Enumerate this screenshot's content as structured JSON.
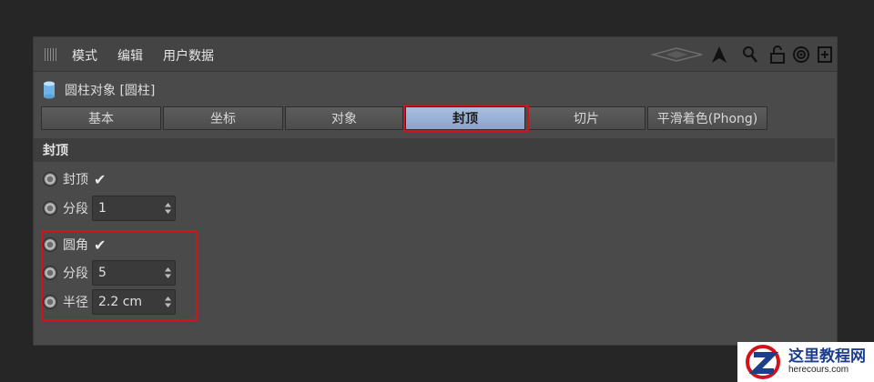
{
  "menubar": {
    "items": [
      "模式",
      "编辑",
      "用户数据"
    ]
  },
  "object_title": "圆柱对象 [圆柱]",
  "tabs": [
    {
      "label": "基本",
      "active": false
    },
    {
      "label": "坐标",
      "active": false
    },
    {
      "label": "对象",
      "active": false
    },
    {
      "label": "封顶",
      "active": true
    },
    {
      "label": "切片",
      "active": false
    },
    {
      "label": "平滑着色(Phong)",
      "active": false
    }
  ],
  "section_title": "封顶",
  "params": {
    "caps": {
      "label": "封顶",
      "checked": true
    },
    "cap_segments": {
      "label": "分段",
      "value": "1"
    },
    "fillet": {
      "label": "圆角",
      "checked": true
    },
    "fillet_segments": {
      "label": "分段",
      "value": "5"
    },
    "fillet_radius": {
      "label": "半径",
      "value": "2.2 cm"
    }
  },
  "check_mark": "✔",
  "highlight_color": "#d4121b",
  "active_tab_color": "#8aa3cb",
  "watermark": {
    "cn": "这里教程网",
    "en": "herecours.com"
  }
}
